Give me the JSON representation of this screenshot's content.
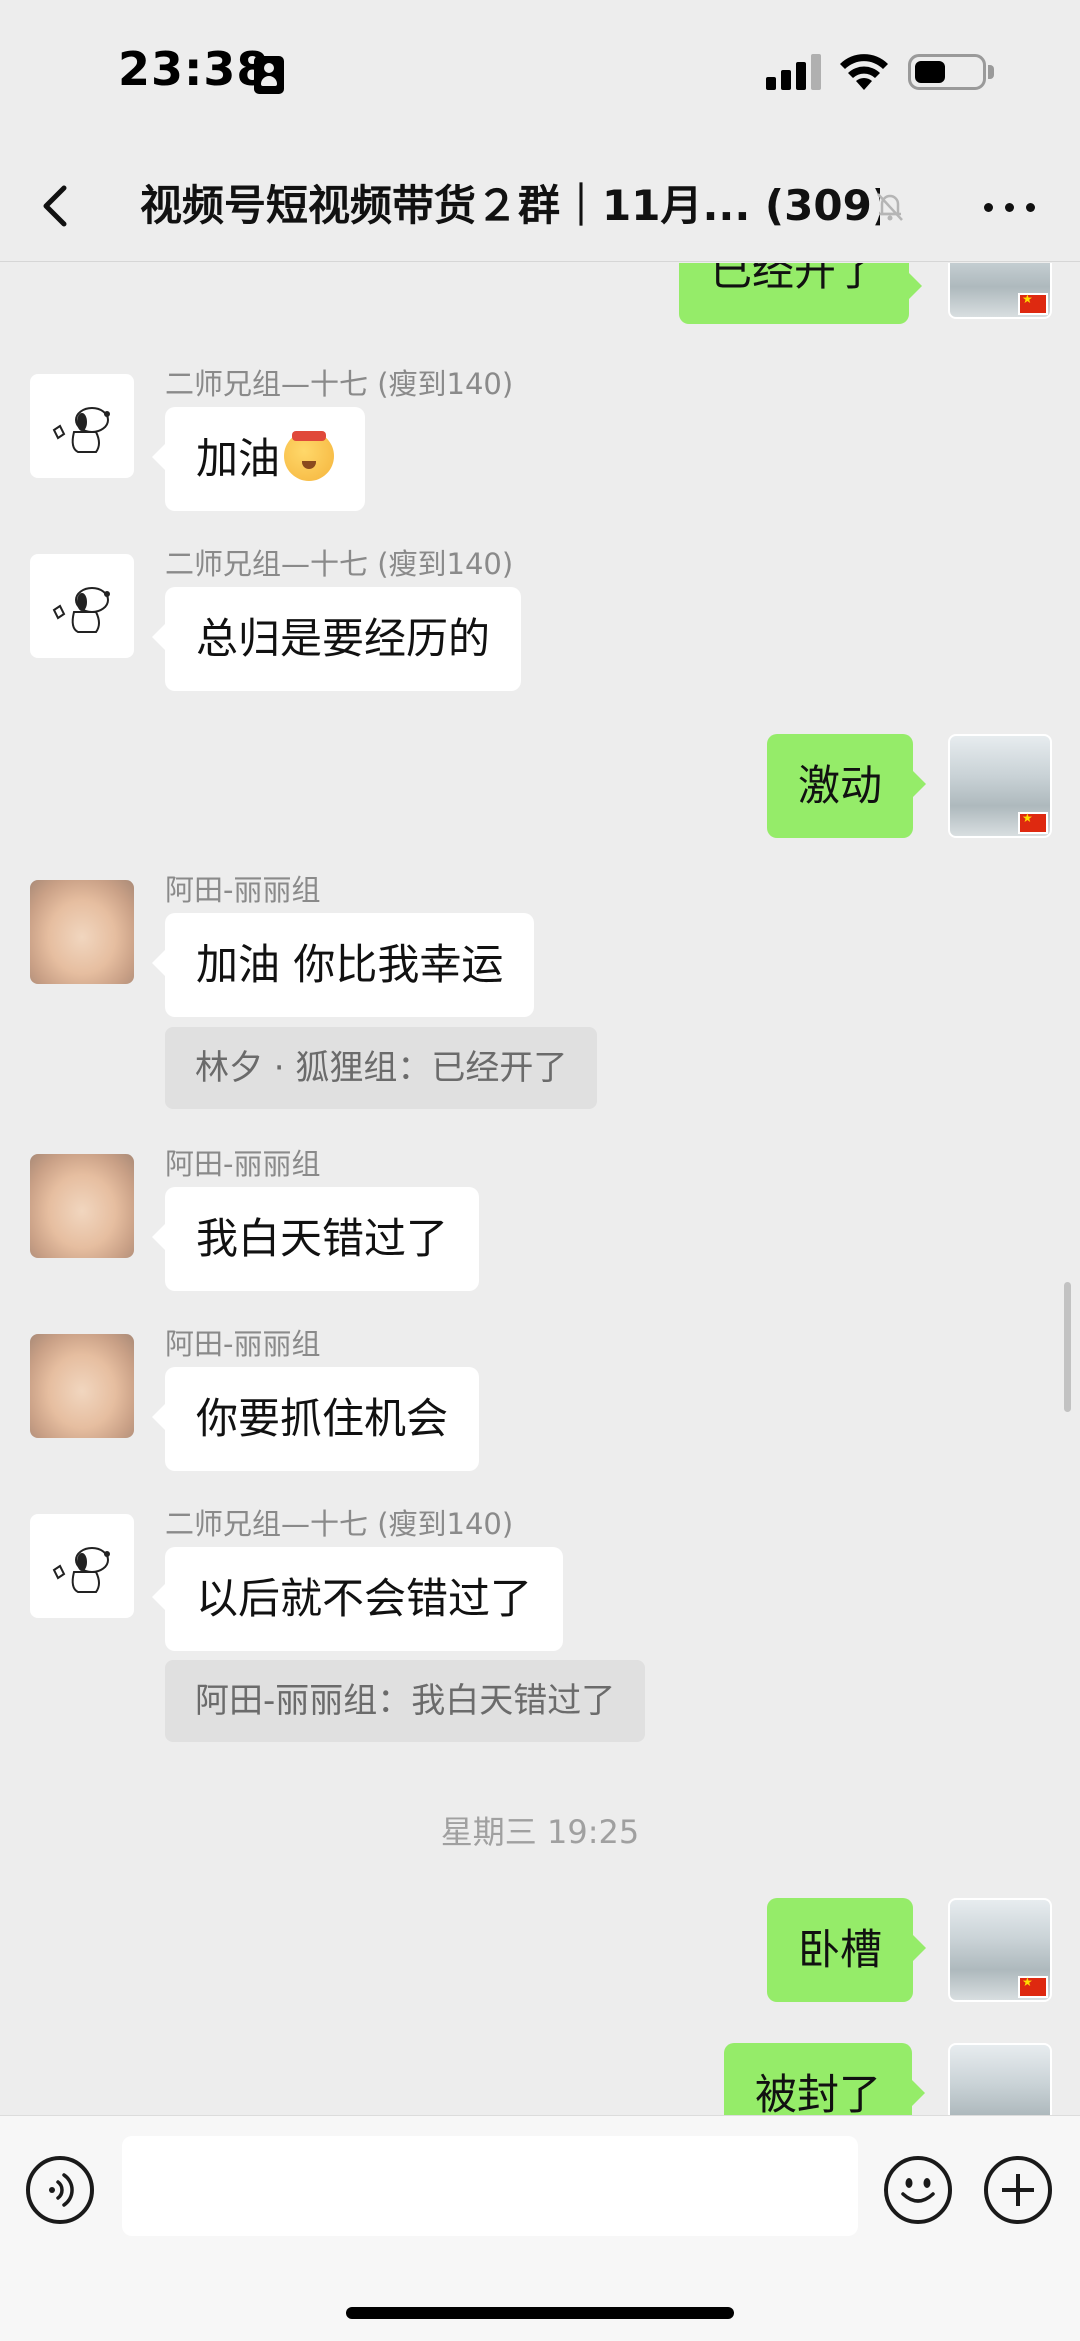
{
  "status_bar": {
    "time": "23:38",
    "battery_level": 0.45
  },
  "nav": {
    "title": "视频号短视频带货２群｜11月... (309)",
    "back_icon": "chevron-left-icon",
    "mute_icon": "bell-slash-icon",
    "more_icon": "ellipsis-icon"
  },
  "colors": {
    "background": "#ededed",
    "outgoing_bubble": "#95ec69",
    "incoming_bubble": "#ffffff",
    "quote_bg": "#e0e0e0"
  },
  "messages": [
    {
      "type": "outgoing",
      "text": "已经开了"
    },
    {
      "type": "incoming",
      "sender": "二师兄组—十七 (瘦到140)",
      "text": "加油",
      "emoji": "headband-hush-emoji"
    },
    {
      "type": "incoming",
      "sender": "二师兄组—十七 (瘦到140)",
      "text": "总归是要经历的"
    },
    {
      "type": "outgoing",
      "text": "激动"
    },
    {
      "type": "incoming",
      "sender": "阿田-丽丽组",
      "text": "加油  你比我幸运",
      "quote": "林夕 · 狐狸组：已经开了"
    },
    {
      "type": "incoming",
      "sender": "阿田-丽丽组",
      "text": "我白天错过了"
    },
    {
      "type": "incoming",
      "sender": "阿田-丽丽组",
      "text": "你要抓住机会"
    },
    {
      "type": "incoming",
      "sender": "二师兄组—十七 (瘦到140)",
      "text": "以后就不会错过了",
      "quote": "阿田-丽丽组：我白天错过了"
    },
    {
      "type": "timestamp",
      "text": "星期三 19:25"
    },
    {
      "type": "outgoing",
      "text": "卧槽"
    },
    {
      "type": "outgoing",
      "text": "被封了"
    }
  ],
  "input_bar": {
    "voice_icon": "voice-icon",
    "emoji_icon": "smiley-icon",
    "plus_icon": "plus-circle-icon",
    "input_value": ""
  }
}
